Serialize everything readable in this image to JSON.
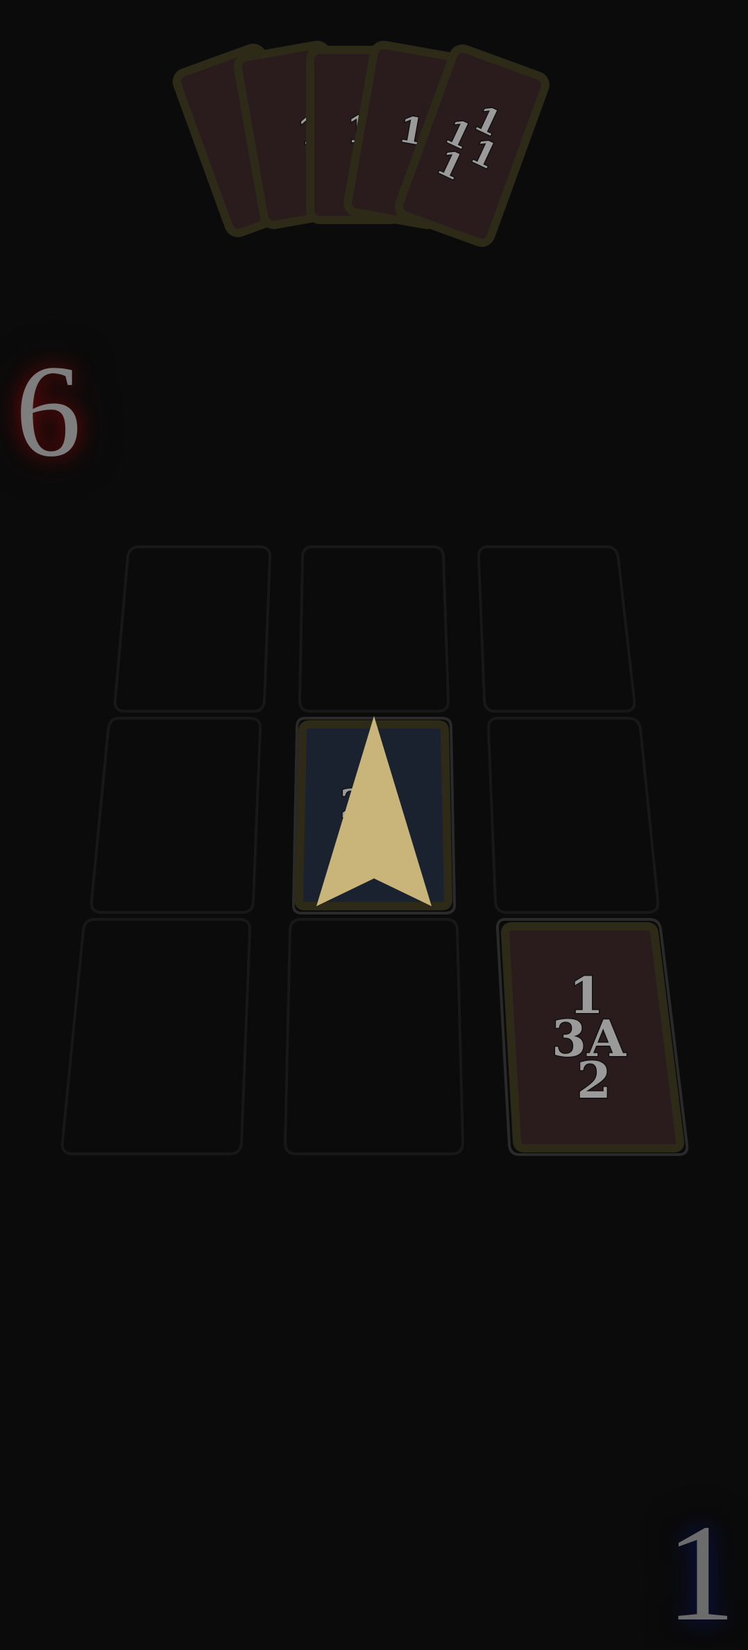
{
  "opponent": {
    "score": "6",
    "hand": [
      {
        "label": "1"
      },
      {
        "label": "1"
      },
      {
        "label": "1"
      },
      {
        "label": "1"
      },
      {
        "label": "1",
        "marks": [
          "1",
          "1",
          "1",
          "1"
        ]
      }
    ]
  },
  "player": {
    "score": "1"
  },
  "board": {
    "slots": [
      {
        "row": 0,
        "col": 0,
        "state": "empty"
      },
      {
        "row": 0,
        "col": 1,
        "state": "empty"
      },
      {
        "row": 0,
        "col": 2,
        "state": "empty"
      },
      {
        "row": 1,
        "col": 0,
        "state": "empty"
      },
      {
        "row": 1,
        "col": 1,
        "state": "face-down",
        "hidden_digit": "2",
        "icon": "arrow-up-icon"
      },
      {
        "row": 1,
        "col": 2,
        "state": "empty"
      },
      {
        "row": 2,
        "col": 0,
        "state": "empty"
      },
      {
        "row": 2,
        "col": 1,
        "state": "empty"
      },
      {
        "row": 2,
        "col": 2,
        "state": "face-up",
        "top": "1",
        "left": "3",
        "right": "A",
        "bottom": "2"
      }
    ]
  },
  "colors": {
    "background": "#0b0b0b",
    "card_red_back": "#2c1c1e",
    "card_border": "#2e2a18",
    "card_blue_back": "#1a2230",
    "arrow_gold": "#c9b57a",
    "slot_outline": "#1a1a1a"
  }
}
